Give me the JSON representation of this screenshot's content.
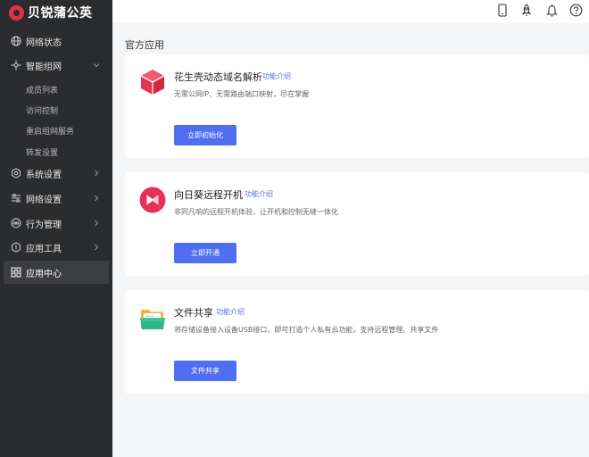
{
  "brand": {
    "name": "贝锐蒲公英",
    "color": "#e5304c"
  },
  "sidebar": {
    "items": [
      {
        "label": "网络状态",
        "icon": "globe-icon"
      },
      {
        "label": "智能组网",
        "icon": "network-icon",
        "expanded": true
      },
      {
        "label": "系统设置",
        "icon": "gear-icon"
      },
      {
        "label": "网络设置",
        "icon": "sliders-icon"
      },
      {
        "label": "行为管理",
        "icon": "behavior-icon"
      },
      {
        "label": "应用工具",
        "icon": "tools-icon"
      },
      {
        "label": "应用中心",
        "icon": "grid-icon",
        "active": true
      }
    ],
    "sub_items": [
      "成员列表",
      "访问控制",
      "重启组网服务",
      "转发设置"
    ]
  },
  "topbar": {
    "icons": [
      "mobile-icon",
      "rocket-icon",
      "bell-icon",
      "help-icon"
    ]
  },
  "main": {
    "section_title": "官方应用",
    "cards": [
      {
        "name": "花生壳动态域名解析",
        "intro": "功能介绍",
        "desc": "无需公网IP、无需路由端口映射，尽在掌握",
        "button": "立即初始化",
        "icon": "peanut-shell-icon"
      },
      {
        "name": "向日葵远程开机",
        "intro": "功能介绍",
        "desc": "非同凡响的远程开机体验，让开机和控制无缝一体化",
        "button": "立即开通",
        "icon": "sunflower-icon"
      },
      {
        "name": "文件共享",
        "intro": "功能介绍",
        "desc": "将存储设备接入设备USB接口，即可打造个人私有云功能，支持远程管理、共享文件",
        "button": "文件共享",
        "icon": "folder-icon"
      }
    ]
  },
  "colors": {
    "accent": "#4f6ef0",
    "sidebar_bg": "#2b2c2e",
    "link": "#5b6fe6"
  }
}
